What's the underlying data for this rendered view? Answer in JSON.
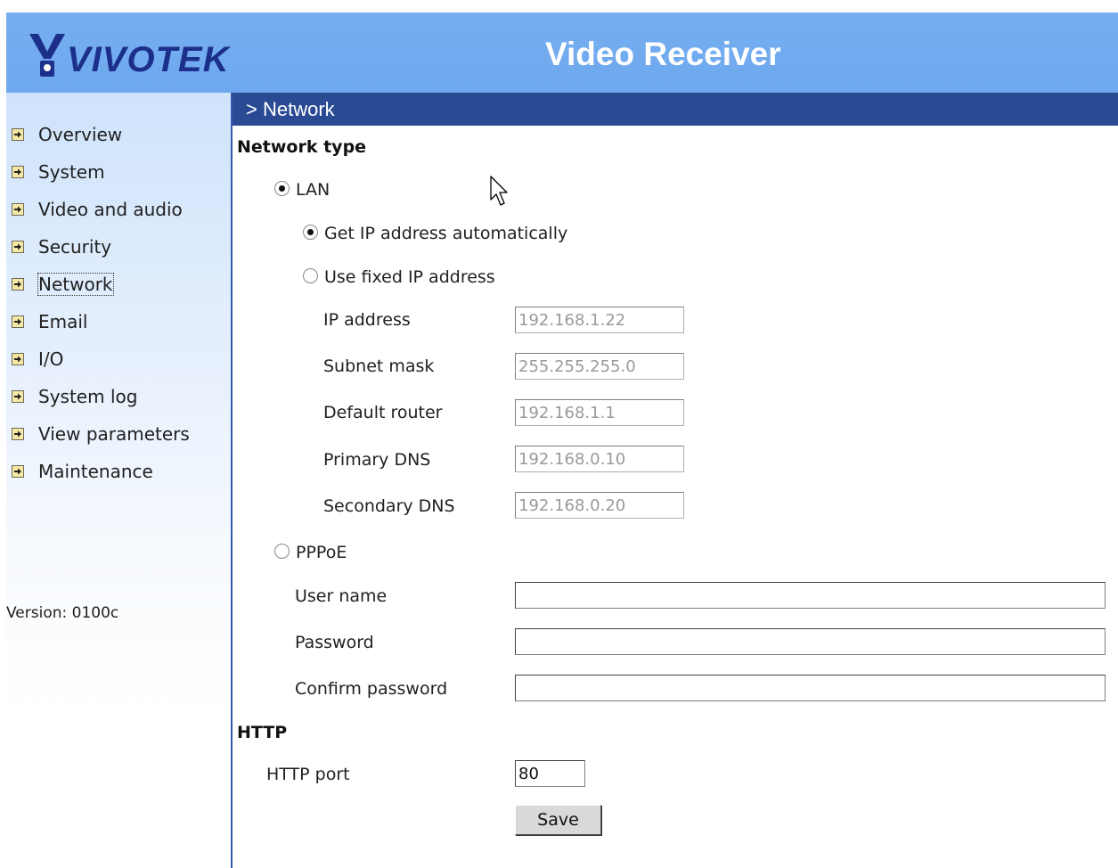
{
  "header": {
    "brand": "VIVOTEK",
    "title": "Video Receiver"
  },
  "sidebar": {
    "items": [
      {
        "label": "Overview"
      },
      {
        "label": "System"
      },
      {
        "label": "Video and audio"
      },
      {
        "label": "Security"
      },
      {
        "label": "Network",
        "active": true
      },
      {
        "label": "Email"
      },
      {
        "label": "I/O"
      },
      {
        "label": "System log"
      },
      {
        "label": "View parameters"
      },
      {
        "label": "Maintenance"
      }
    ],
    "version": "Version: 0100c"
  },
  "main": {
    "section_title": "> Network",
    "network_type": {
      "heading": "Network type",
      "lan_label": "LAN",
      "lan_selected": true,
      "auto_ip_label": "Get IP address automatically",
      "auto_ip_selected": true,
      "fixed_ip_label": "Use fixed IP address",
      "fixed_ip_selected": false,
      "ip_address_label": "IP address",
      "ip_address_value": "192.168.1.22",
      "subnet_mask_label": "Subnet mask",
      "subnet_mask_value": "255.255.255.0",
      "default_router_label": "Default router",
      "default_router_value": "192.168.1.1",
      "primary_dns_label": "Primary DNS",
      "primary_dns_value": "192.168.0.10",
      "secondary_dns_label": "Secondary DNS",
      "secondary_dns_value": "192.168.0.20",
      "pppoe_label": "PPPoE",
      "pppoe_selected": false,
      "user_name_label": "User name",
      "user_name_value": "",
      "password_label": "Password",
      "password_value": "",
      "confirm_password_label": "Confirm password",
      "confirm_password_value": ""
    },
    "http": {
      "heading": "HTTP",
      "port_label": "HTTP port",
      "port_value": "80"
    },
    "save_label": "Save"
  },
  "colors": {
    "header_bg": "#6ea8ee",
    "section_bar_bg": "#2a4a94",
    "brand_text": "#1c2f8a",
    "nav_arrow_bg": "#f6e7a3"
  }
}
